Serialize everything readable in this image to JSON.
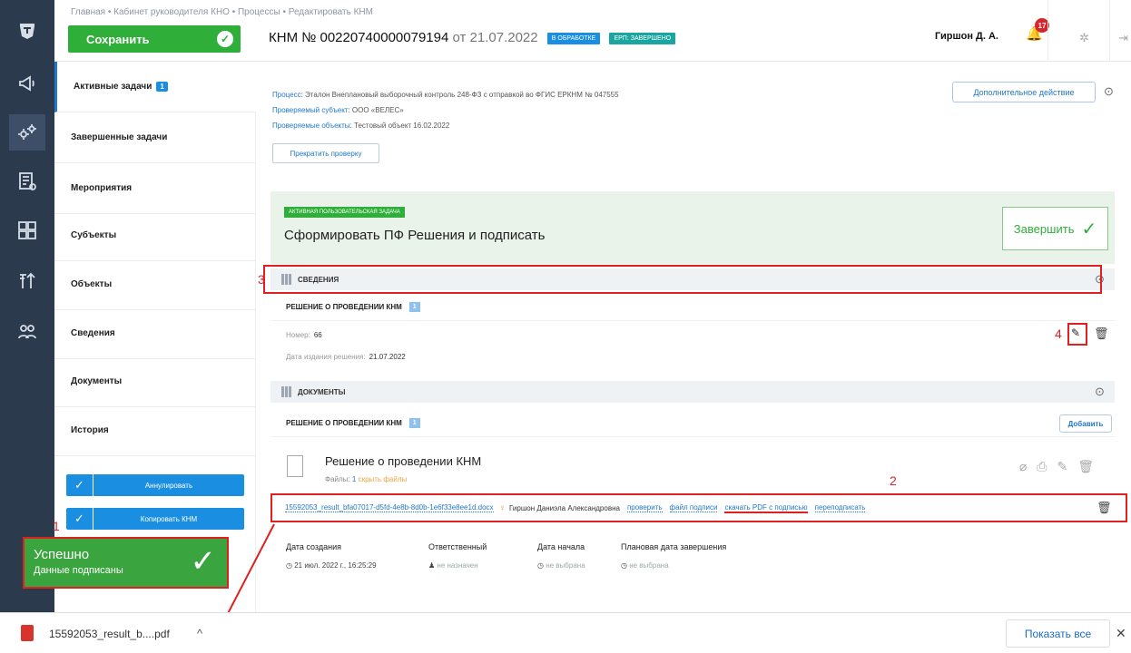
{
  "header": {
    "breadcrumb": "Главная  •  Кабинет руководителя КНО  •  Процессы  •  Редактировать КНМ",
    "save_label": "Сохранить",
    "title_prefix": "КНМ № 00220740000079194",
    "title_date": "от 21.07.2022",
    "status_badge": "В ОБРАБОТКЕ",
    "erp_badge": "ЕРП: ЗАВЕРШЕНО",
    "user": "Гиршон Д. А.",
    "notifications": "17"
  },
  "sidebar": {
    "items": [
      {
        "label": "Активные задачи",
        "count": "1"
      },
      {
        "label": "Завершенные задачи"
      },
      {
        "label": "Мероприятия"
      },
      {
        "label": "Субъекты"
      },
      {
        "label": "Объекты"
      },
      {
        "label": "Сведения"
      },
      {
        "label": "Документы"
      },
      {
        "label": "История"
      }
    ],
    "annul_label": "Аннулировать",
    "copy_label": "Копировать КНМ"
  },
  "toast": {
    "title": "Успешно",
    "message": "Данные подписаны"
  },
  "markers": {
    "m1": "1",
    "m2": "2",
    "m3": "3",
    "m4": "4"
  },
  "process": {
    "process_key": "Процесс:",
    "process_val": "Эталон Внеплановый выборочный контроль 248-ФЗ с отправкой во ФГИС ЕРКНМ № 047555",
    "subject_key": "Проверяемый субъект:",
    "subject_val": "ООО «ВЕЛЕС»",
    "objects_key": "Проверяемые объекты:",
    "objects_val": "Тестовый объект 16.02.2022",
    "stop_label": "Прекратить проверку",
    "extra_label": "Дополнительное действие"
  },
  "task": {
    "badge": "АКТИВНАЯ ПОЛЬЗОВАТЕЛЬСКАЯ ЗАДАЧА",
    "title": "Сформировать ПФ Решения и подписать",
    "finish_label": "Завершить"
  },
  "details": {
    "section_label": "СВЕДЕНИЯ",
    "sub_title": "РЕШЕНИЕ О ПРОВЕДЕНИИ КНМ",
    "sub_count": "1",
    "number_label": "Номер:",
    "number_value": "66",
    "date_label": "Дата издания решения:",
    "date_value": "21.07.2022"
  },
  "documents": {
    "section_label": "ДОКУМЕНТЫ",
    "sub_title": "РЕШЕНИЕ О ПРОВЕДЕНИИ КНМ",
    "sub_count": "1",
    "add_label": "Добавить",
    "doc_title": "Решение о проведении КНМ",
    "files_label": "Файлы:",
    "files_count": "1",
    "hide_files": "скрыть файлы",
    "file_name": "15592053_result_bfa07017-d5fd-4e8b-8d0b-1e6f33e8ee1d.docx",
    "signer": "Гиршон Даниэла Александровна",
    "check_link": "проверить",
    "sig_file_link": "файл подписи",
    "download_pdf_link": "скачать PDF с подписью",
    "resign_link": "переподписать"
  },
  "meta": {
    "created_label": "Дата создания",
    "created_value": "21 июл. 2022 г., 16:25:29",
    "resp_label": "Ответственный",
    "resp_value": "не назначен",
    "start_label": "Дата начала",
    "start_value": "не выбрана",
    "planned_label": "Плановая дата завершения",
    "planned_value": "не выбрана"
  },
  "download_bar": {
    "file": "15592053_result_b....pdf",
    "show_all": "Показать все"
  },
  "colors": {
    "rail": "#2b3a4d",
    "primary": "#1a8ee0",
    "success": "#2fae3a",
    "highlight": "#e02020"
  }
}
